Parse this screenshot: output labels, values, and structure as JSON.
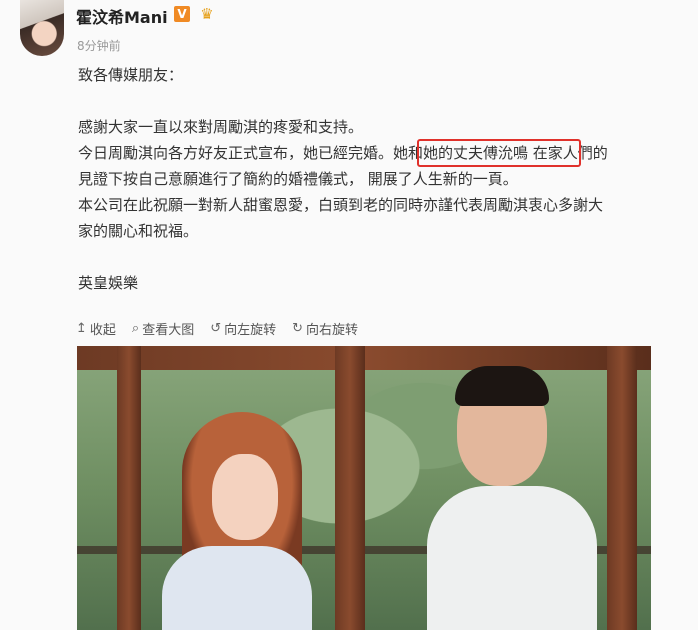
{
  "user": {
    "name": "霍汶希Mani",
    "verified_icon": "v-badge-icon",
    "vip_icon": "vip-icon",
    "timestamp": "8分钟前"
  },
  "post": {
    "lines": [
      "致各傳媒朋友：",
      "",
      "感謝大家一直以來對周勵淇的疼愛和支持。",
      "今日周勵淇向各方好友正式宣布，她已經完婚。她和她的丈夫傅沇鳴 在家人們的",
      "見證下按自己意願進行了簡約的婚禮儀式， 開展了人生新的一頁。",
      "本公司在此祝願一對新人甜蜜恩愛，白頭到老的同時亦謹代表周勵淇衷心多謝大",
      "家的關心和祝福。",
      "",
      "英皇娛樂"
    ],
    "highlight_color": "#e0312b"
  },
  "toolbar": {
    "collapse": "收起",
    "view_large": "查看大图",
    "rotate_left": "向左旋转",
    "rotate_right": "向右旋转"
  }
}
